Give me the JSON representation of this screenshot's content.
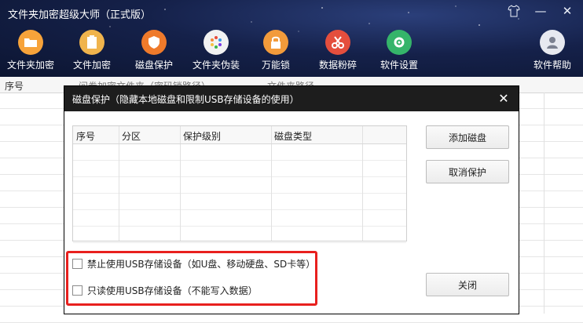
{
  "app": {
    "title": "文件夹加密超级大师（正式版）"
  },
  "window_controls": [
    {
      "name": "shirt-icon",
      "glyph": "👕"
    },
    {
      "name": "minimize-icon",
      "glyph": "—"
    },
    {
      "name": "close-icon",
      "glyph": "✕"
    }
  ],
  "toolbar": [
    {
      "id": "folder-encrypt",
      "label": "文件夹加密",
      "icon": "folder-icon",
      "color": "#f7a33a"
    },
    {
      "id": "file-encrypt",
      "label": "文件加密",
      "icon": "file-icon",
      "color": "#f0b44d"
    },
    {
      "id": "disk-protect",
      "label": "磁盘保护",
      "icon": "shield-icon",
      "color": "#ef7a2b"
    },
    {
      "id": "folder-disguise",
      "label": "文件夹伪装",
      "icon": "palette-icon",
      "color": "#f2f2f2"
    },
    {
      "id": "master-lock",
      "label": "万能锁",
      "icon": "padlock-icon",
      "color": "#f29b3b"
    },
    {
      "id": "data-shred",
      "label": "数据粉碎",
      "icon": "scissors-icon",
      "color": "#e44e3d"
    },
    {
      "id": "settings",
      "label": "软件设置",
      "icon": "gear-icon",
      "color": "#35b46a"
    },
    {
      "id": "help",
      "label": "软件帮助",
      "icon": "user-icon",
      "color": "#e7e9f0"
    }
  ],
  "background_table": {
    "columns": [
      "序号",
      "问卷加密文件夹（密码锁路径）",
      "文件夹路径"
    ]
  },
  "dialog": {
    "title": "磁盘保护（隐藏本地磁盘和限制USB存储设备的使用）",
    "table": {
      "columns": [
        "序号",
        "分区",
        "保护级别",
        "磁盘类型"
      ],
      "rows": []
    },
    "buttons": {
      "add": "添加磁盘",
      "cancel": "取消保护",
      "close": "关闭"
    },
    "options": [
      {
        "label": "禁止使用USB存储设备（如U盘、移动硬盘、SD卡等）",
        "checked": false
      },
      {
        "label": "只读使用USB存储设备（不能写入数据）",
        "checked": false
      }
    ]
  }
}
